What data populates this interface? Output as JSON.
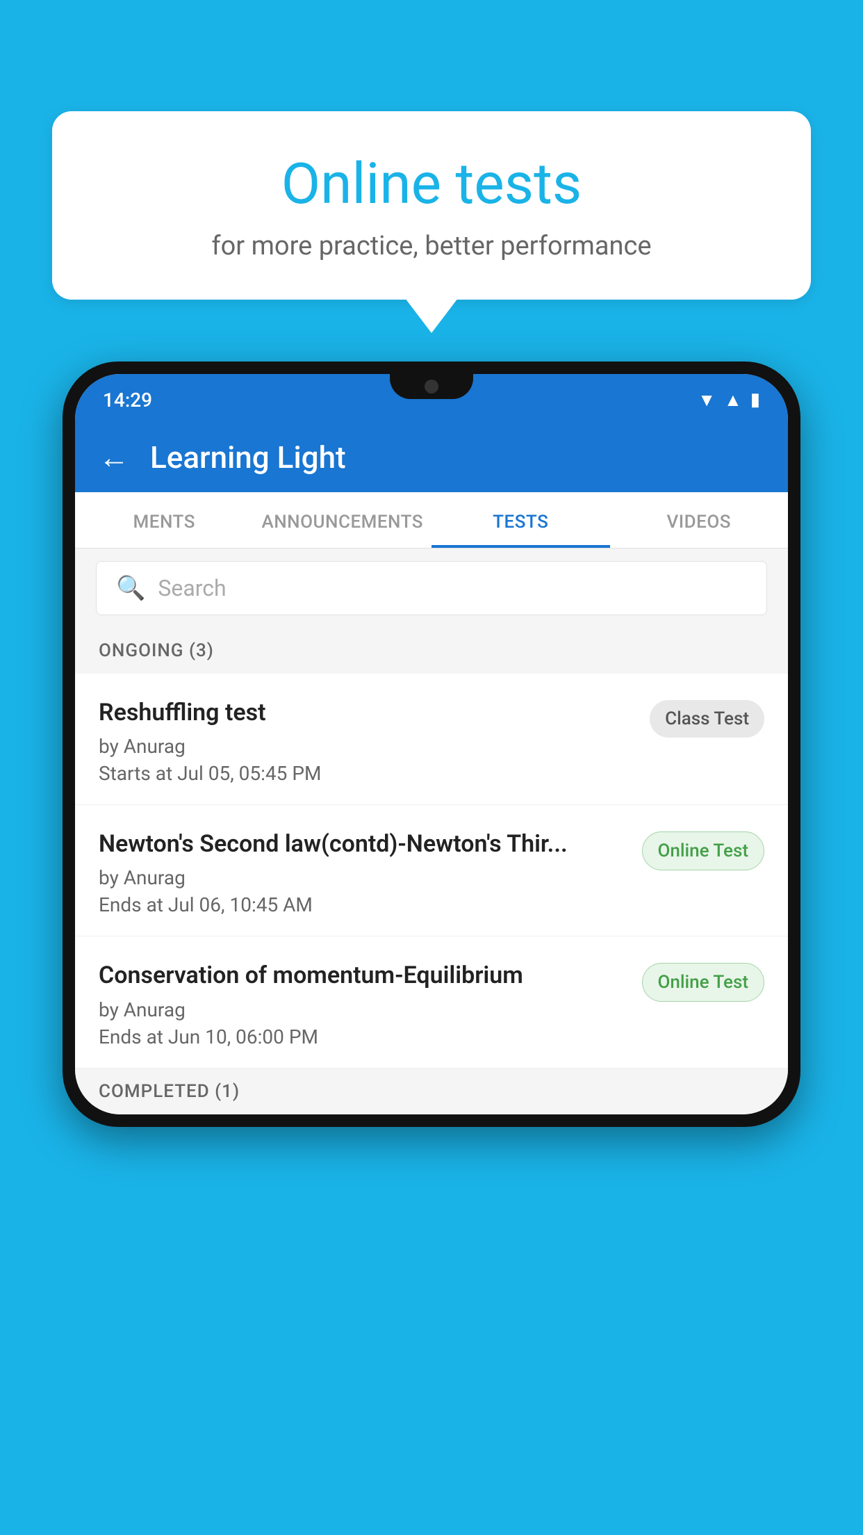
{
  "background": {
    "color": "#1ab3e8"
  },
  "speech_bubble": {
    "title": "Online tests",
    "subtitle": "for more practice, better performance"
  },
  "phone": {
    "status_bar": {
      "time": "14:29",
      "icons": [
        "wifi",
        "signal",
        "battery"
      ]
    },
    "header": {
      "back_label": "←",
      "title": "Learning Light"
    },
    "tabs": [
      {
        "label": "MENTS",
        "active": false
      },
      {
        "label": "ANNOUNCEMENTS",
        "active": false
      },
      {
        "label": "TESTS",
        "active": true
      },
      {
        "label": "VIDEOS",
        "active": false
      }
    ],
    "search": {
      "placeholder": "Search"
    },
    "ongoing_section": {
      "header": "ONGOING (3)",
      "items": [
        {
          "name": "Reshuffling test",
          "author": "by Anurag",
          "time_label": "Starts at",
          "time": "Jul 05, 05:45 PM",
          "badge": "Class Test",
          "badge_type": "class"
        },
        {
          "name": "Newton's Second law(contd)-Newton's Thir...",
          "author": "by Anurag",
          "time_label": "Ends at",
          "time": "Jul 06, 10:45 AM",
          "badge": "Online Test",
          "badge_type": "online"
        },
        {
          "name": "Conservation of momentum-Equilibrium",
          "author": "by Anurag",
          "time_label": "Ends at",
          "time": "Jun 10, 06:00 PM",
          "badge": "Online Test",
          "badge_type": "online"
        }
      ]
    },
    "completed_section": {
      "header": "COMPLETED (1)"
    }
  }
}
